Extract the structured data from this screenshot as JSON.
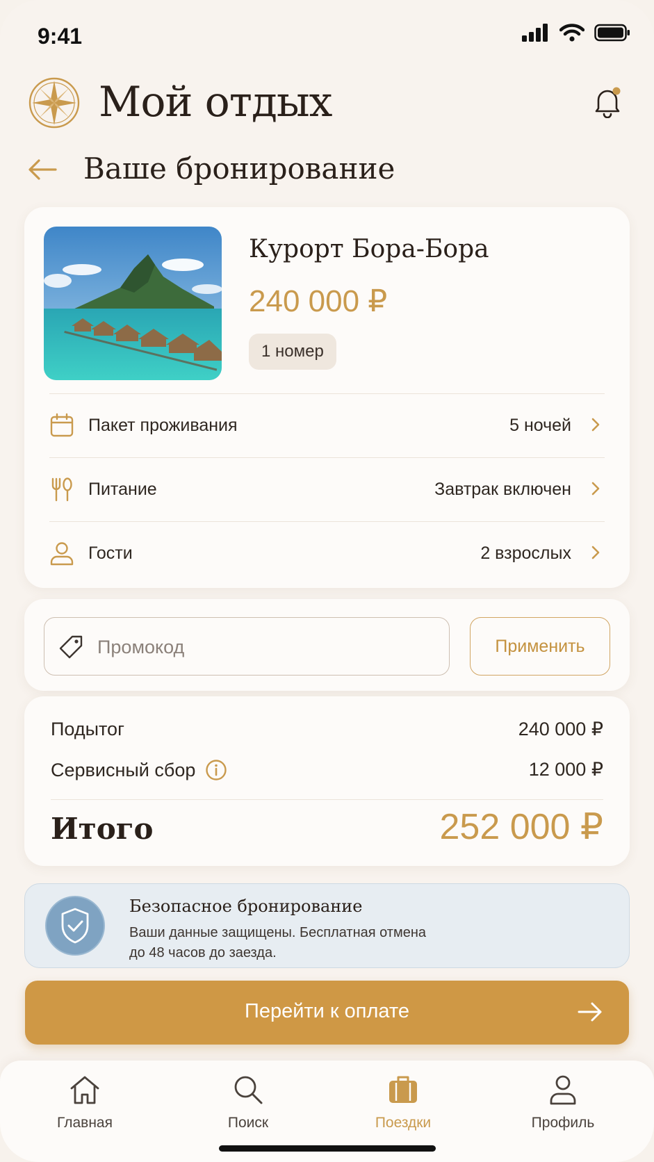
{
  "status_bar": {
    "time": "9:41"
  },
  "header": {
    "app_title": "Мой отдых",
    "logo_icon": "compass-icon",
    "notification_icon": "bell-icon"
  },
  "page": {
    "title": "Ваше бронирование",
    "back_icon": "arrow-left-icon"
  },
  "booking": {
    "resort_name": "Курорт Бора-Бора",
    "price": "240 000 ₽",
    "rooms": "1 номер",
    "details": [
      {
        "icon": "calendar-icon",
        "label": "Пакет проживания",
        "value": "5 ночей"
      },
      {
        "icon": "fork-spoon-icon",
        "label": "Питание",
        "value": "Завтрак включен"
      },
      {
        "icon": "user-icon",
        "label": "Гости",
        "value": "2 взрослых"
      }
    ]
  },
  "promo": {
    "placeholder": "Промокод",
    "value": "",
    "apply_label": "Применить"
  },
  "summary": {
    "subtotal_label": "Подытог",
    "subtotal_value": "240 000 ₽",
    "fee_label": "Сервисный сбор",
    "fee_value": "12 000 ₽",
    "total_label": "Итого",
    "total_value": "252 000 ₽"
  },
  "secure": {
    "title": "Безопасное бронирование",
    "text_line1": "Ваши данные защищены. Бесплатная отмена",
    "text_line2": "до 48 часов до заезда."
  },
  "pay_button": {
    "label": "Перейти к оплате"
  },
  "tabs": [
    {
      "icon": "home-icon",
      "label": "Главная",
      "active": false
    },
    {
      "icon": "search-icon",
      "label": "Поиск",
      "active": false
    },
    {
      "icon": "suitcase-icon",
      "label": "Поездки",
      "active": true
    },
    {
      "icon": "profile-icon",
      "label": "Профиль",
      "active": false
    }
  ],
  "colors": {
    "accent": "#c99a4d",
    "pay_button": "#cf9845",
    "background": "#f8f3ee",
    "secure_bg": "#e7edf2",
    "shield": "#7fa3c2"
  }
}
